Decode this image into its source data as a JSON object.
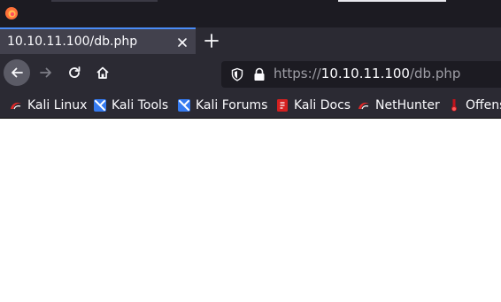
{
  "tab": {
    "title": "10.10.11.100/db.php"
  },
  "url": {
    "scheme": "https://",
    "host": "10.10.11.100",
    "path": "/db.php"
  },
  "bookmarks": [
    {
      "label": "Kali Linux",
      "icon": "kali-dragon-icon"
    },
    {
      "label": "Kali Tools",
      "icon": "kali-tools-icon"
    },
    {
      "label": "Kali Forums",
      "icon": "kali-forums-icon"
    },
    {
      "label": "Kali Docs",
      "icon": "kali-docs-icon"
    },
    {
      "label": "NetHunter",
      "icon": "nethunter-icon"
    },
    {
      "label": "Offens",
      "icon": "offsec-icon"
    }
  ],
  "colors": {
    "toolbar": "#2b2a33",
    "titlebar": "#1c1b22",
    "tab_accent": "#4a8cf7",
    "urlbar": "#1c1b22",
    "page": "#ffffff"
  }
}
